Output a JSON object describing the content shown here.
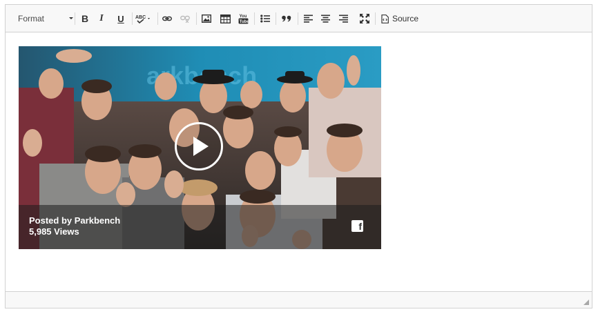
{
  "toolbar": {
    "format_label": "Format",
    "bold_label": "B",
    "italic_label": "I",
    "underline_label": "U",
    "source_label": "Source",
    "icons": [
      "bold-icon",
      "italic-icon",
      "underline-icon",
      "spellcheck-icon",
      "link-icon",
      "unlink-icon",
      "image-icon",
      "table-icon",
      "youtube-icon",
      "bulleted-list-icon",
      "blockquote-icon",
      "align-left-icon",
      "align-center-icon",
      "align-right-icon",
      "maximize-icon",
      "source-icon"
    ]
  },
  "video": {
    "posted_prefix": "Posted by ",
    "author": "Parkbench",
    "views": "5,985 Views",
    "facebook_glyph": "f"
  },
  "colors": {
    "toolbar_bg": "#f8f8f8",
    "border": "#d1d1d1",
    "wall_blue": "#1e95bd"
  }
}
